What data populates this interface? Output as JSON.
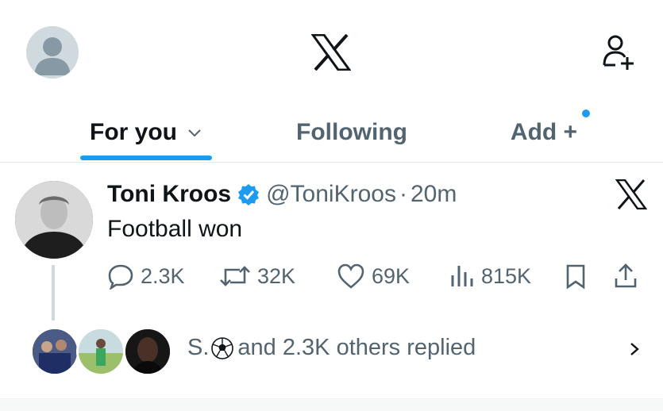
{
  "header": {
    "logo": "x-logo-icon",
    "add_user_icon": "add-user-icon"
  },
  "tabs": [
    {
      "label": "For you",
      "active": true
    },
    {
      "label": "Following",
      "active": false
    },
    {
      "label": "Add +",
      "active": false
    }
  ],
  "tweet": {
    "name": "Toni Kroos",
    "handle": "@ToniKroos",
    "separator": "·",
    "time": "20m",
    "text": "Football won",
    "actions": {
      "replies": "2.3K",
      "reposts": "32K",
      "likes": "69K",
      "views": "815K"
    }
  },
  "replied": {
    "name": "S.",
    "suffix": "and 2.3K others replied"
  },
  "colors": {
    "accent": "#1d9bf0",
    "text": "#0f1419",
    "muted": "#536471"
  }
}
